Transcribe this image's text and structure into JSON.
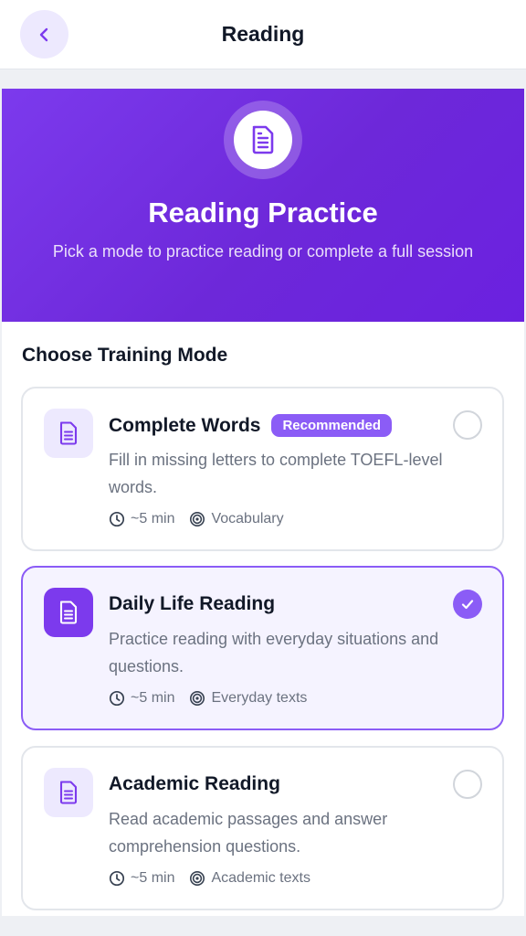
{
  "header": {
    "title": "Reading",
    "back_icon": "chevron-left-icon"
  },
  "hero": {
    "icon": "document-icon",
    "title": "Reading Practice",
    "subtitle": "Pick a mode to practice reading or complete a full session"
  },
  "section": {
    "title": "Choose Training Mode"
  },
  "modes": [
    {
      "title": "Complete Words",
      "badge": "Recommended",
      "description": "Fill in missing letters to complete TOEFL-level words.",
      "duration": "~5 min",
      "focus": "Vocabulary",
      "selected": false
    },
    {
      "title": "Daily Life Reading",
      "badge": "",
      "description": "Practice reading with everyday situations and questions.",
      "duration": "~5 min",
      "focus": "Everyday texts",
      "selected": true
    },
    {
      "title": "Academic Reading",
      "badge": "",
      "description": "Read academic passages and answer comprehension questions.",
      "duration": "~5 min",
      "focus": "Academic texts",
      "selected": false
    }
  ],
  "colors": {
    "accent": "#7c3aed",
    "accent_light": "#ede9fe",
    "selected_bg": "#f5f3ff",
    "text_muted": "#6b7280"
  }
}
